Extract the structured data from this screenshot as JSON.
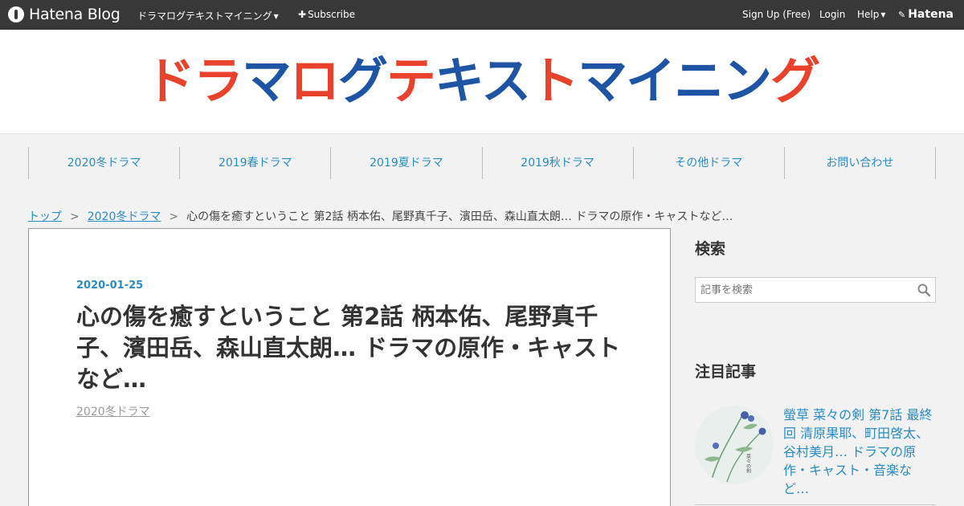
{
  "topbar": {
    "brand": "Hatena Blog",
    "blog_menu": "ドラマログテキストマイニング",
    "subscribe": "Subscribe",
    "signup": "Sign Up (Free)",
    "login": "Login",
    "help": "Help",
    "hatena": "Hatena"
  },
  "header": {
    "logo_text": "ドラマログテキストマイニング"
  },
  "nav": [
    {
      "label": "2020冬ドラマ"
    },
    {
      "label": "2019春ドラマ"
    },
    {
      "label": "2019夏ドラマ"
    },
    {
      "label": "2019秋ドラマ"
    },
    {
      "label": "その他ドラマ"
    },
    {
      "label": "お問い合わせ"
    }
  ],
  "breadcrumb": {
    "home": "トップ",
    "category": "2020冬ドラマ",
    "current": "心の傷を癒すということ 第2話 柄本佑、尾野真千子、濱田岳、森山直太朗… ドラマの原作・キャストなど…"
  },
  "article": {
    "date": "2020-01-25",
    "title": "心の傷を癒すということ 第2話 柄本佑、尾野真千子、濱田岳、森山直太朗… ドラマの原作・キャストなど…",
    "category": "2020冬ドラマ"
  },
  "sidebar": {
    "search_heading": "検索",
    "search_placeholder": "記事を検索",
    "featured_heading": "注目記事",
    "featured_title": "螢草 菜々の剣 第7話 最終回 清原果耶、町田啓太、谷村美月… ドラマの原作・キャスト・音楽など…",
    "thumb_caption": "菜々の剣"
  }
}
